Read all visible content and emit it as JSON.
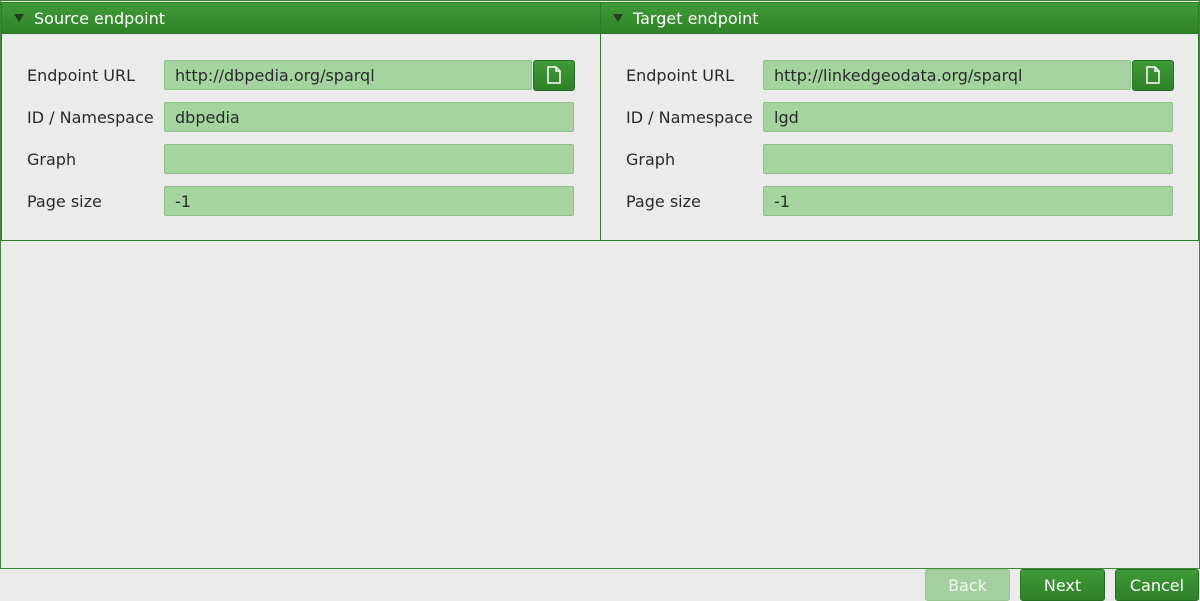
{
  "source": {
    "title": "Source endpoint",
    "endpoint_url_label": "Endpoint URL",
    "endpoint_url": "http://dbpedia.org/sparql",
    "namespace_label": "ID / Namespace",
    "namespace": "dbpedia",
    "graph_label": "Graph",
    "graph": "",
    "page_size_label": "Page size",
    "page_size": "-1"
  },
  "target": {
    "title": "Target endpoint",
    "endpoint_url_label": "Endpoint URL",
    "endpoint_url": "http://linkedgeodata.org/sparql",
    "namespace_label": "ID / Namespace",
    "namespace": "lgd",
    "graph_label": "Graph",
    "graph": "",
    "page_size_label": "Page size",
    "page_size": "-1"
  },
  "footer": {
    "back_label": "Back",
    "next_label": "Next",
    "cancel_label": "Cancel"
  },
  "icons": {
    "collapse": "triangle-down-icon",
    "file": "file-icon"
  },
  "colors": {
    "accent": "#2f8329",
    "field_bg": "#a5d4a0",
    "disabled_button": "#a5cfa0"
  }
}
